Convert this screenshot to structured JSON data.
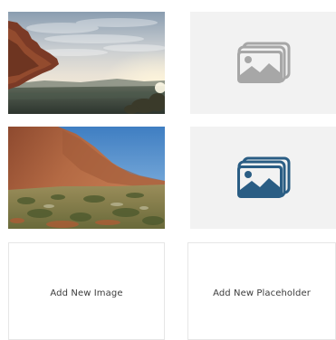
{
  "gallery": {
    "tiles": [
      {
        "kind": "photo",
        "icon": "cliff-sunset-photo"
      },
      {
        "kind": "placeholder",
        "icon": "image-placeholder-icon",
        "icon_color": "#a7a7a7"
      },
      {
        "kind": "photo",
        "icon": "red-rock-desert-photo"
      },
      {
        "kind": "placeholder",
        "icon": "image-placeholder-icon",
        "icon_color": "#2a5d84"
      }
    ],
    "add_image_label": "Add New Image",
    "add_placeholder_label": "Add New Placeholder"
  }
}
